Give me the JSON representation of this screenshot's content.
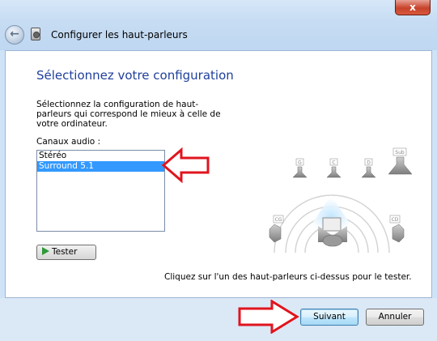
{
  "window": {
    "title": "Configurer les haut-parleurs",
    "close_glyph": "x",
    "back_glyph": "←"
  },
  "page": {
    "heading": "Sélectionnez votre configuration",
    "description": "Sélectionnez la configuration de haut-parleurs qui correspond le mieux à celle de votre ordinateur.",
    "channels_label": "Canaux audio :",
    "channels": [
      {
        "label": "Stéréo",
        "selected": false
      },
      {
        "label": "Surround 5.1",
        "selected": true
      }
    ],
    "test_button_label": "Tester",
    "hint": "Cliquez sur l'un des haut-parleurs ci-dessus pour le tester."
  },
  "speakers": {
    "front_left": "G",
    "center": "C",
    "front_right": "D",
    "subwoofer": "Sub",
    "surround_left": "CG",
    "surround_right": "CD"
  },
  "footer": {
    "next_label": "Suivant",
    "cancel_label": "Annuler"
  },
  "colors": {
    "heading": "#1f3f9b",
    "selection": "#3399ff",
    "annotation_arrow": "#e0141e",
    "play_icon": "#2e9a3a"
  },
  "icons": [
    "back-arrow-icon",
    "speaker-config-icon",
    "close-icon",
    "play-icon",
    "speaker-icon",
    "listener-icon"
  ]
}
